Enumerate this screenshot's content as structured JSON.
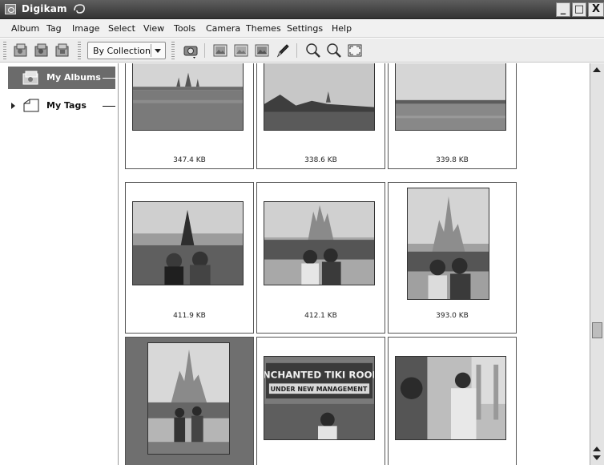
{
  "window": {
    "title": "Digikam",
    "controls": {
      "minimize": "_",
      "maximize": "□",
      "close": "X"
    }
  },
  "menu": [
    "Album",
    "Tag",
    "Image",
    "Select",
    "View",
    "Tools",
    "Camera",
    "Themes",
    "Settings",
    "Help"
  ],
  "toolbar": {
    "sort_select_value": "By Collection",
    "buttons": [
      "new-album-icon",
      "delete-album-icon",
      "album-properties-icon",
      "camera-icon",
      "view-image-icon",
      "edit-image-icon",
      "image-properties-icon",
      "pencil-icon",
      "zoom-in-icon",
      "zoom-out-icon",
      "fullscreen-icon"
    ]
  },
  "sidebar": {
    "items": [
      {
        "label": "My Albums",
        "selected": true
      },
      {
        "label": "My Tags",
        "selected": false
      }
    ]
  },
  "thumbnails": [
    {
      "size": "347.4 KB",
      "selected": false,
      "scene": "castle-lake"
    },
    {
      "size": "338.6 KB",
      "selected": false,
      "scene": "castle-shore"
    },
    {
      "size": "339.8 KB",
      "selected": false,
      "scene": "lake"
    },
    {
      "size": "411.9 KB",
      "selected": false,
      "scene": "christmas-tree"
    },
    {
      "size": "412.1 KB",
      "selected": false,
      "scene": "castle-people"
    },
    {
      "size": "393.0 KB",
      "selected": false,
      "scene": "castle-portrait"
    },
    {
      "size": "",
      "selected": true,
      "scene": "castle-tall"
    },
    {
      "size": "",
      "selected": false,
      "scene": "tiki-room-sign"
    },
    {
      "size": "",
      "selected": false,
      "scene": "veranda"
    }
  ],
  "sign_text": "ENCHANTED TIKI ROOM · UNDER NEW MANAGEMENT",
  "colors": {
    "selection": "#6b6b6b",
    "titlebar": "#444444"
  }
}
